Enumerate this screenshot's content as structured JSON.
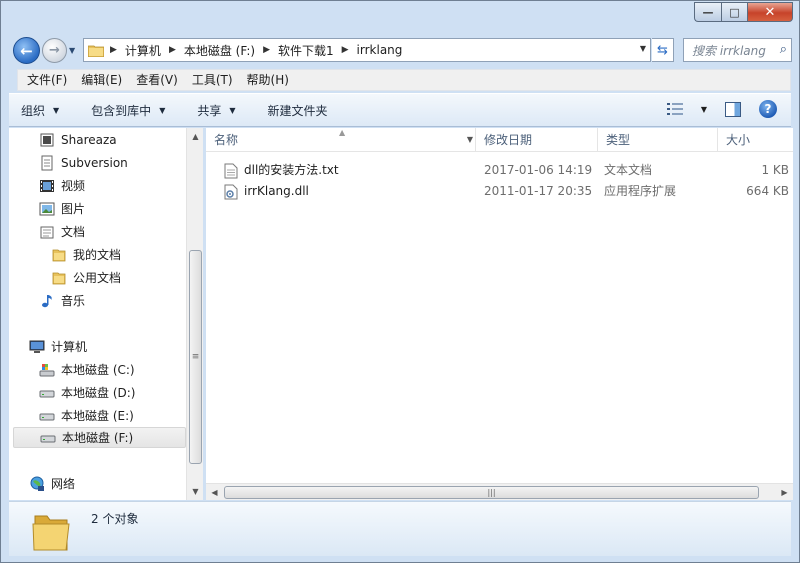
{
  "window": {
    "controls": {
      "minimize": "—",
      "maximize": "□",
      "close": "✕"
    }
  },
  "address": {
    "crumbs": [
      "计算机",
      "本地磁盘 (F:)",
      "软件下载1",
      "irrklang"
    ],
    "search_placeholder": "搜索 irrklang"
  },
  "menu": [
    "文件(F)",
    "编辑(E)",
    "查看(V)",
    "工具(T)",
    "帮助(H)"
  ],
  "commands": {
    "organize": "组织",
    "include_in_library": "包含到库中",
    "share": "共享",
    "new_folder": "新建文件夹"
  },
  "nav_pane": {
    "items": [
      {
        "label": "Shareaza",
        "icon": "shareaza-icon"
      },
      {
        "label": "Subversion",
        "icon": "subversion-icon"
      },
      {
        "label": "视频",
        "icon": "video-library-icon"
      },
      {
        "label": "图片",
        "icon": "pictures-library-icon"
      },
      {
        "label": "文档",
        "icon": "documents-library-icon"
      },
      {
        "label": "我的文档",
        "icon": "folder-icon"
      },
      {
        "label": "公用文档",
        "icon": "folder-icon"
      },
      {
        "label": "音乐",
        "icon": "music-library-icon"
      },
      {
        "label": "计算机",
        "icon": "computer-icon"
      },
      {
        "label": "本地磁盘 (C:)",
        "icon": "system-drive-icon"
      },
      {
        "label": "本地磁盘 (D:)",
        "icon": "drive-icon"
      },
      {
        "label": "本地磁盘 (E:)",
        "icon": "drive-icon"
      },
      {
        "label": "本地磁盘 (F:)",
        "icon": "drive-icon"
      },
      {
        "label": "网络",
        "icon": "network-icon"
      }
    ],
    "selected": "本地磁盘 (F:)"
  },
  "file_list": {
    "columns": [
      "名称",
      "修改日期",
      "类型",
      "大小"
    ],
    "files": [
      {
        "name": "dll的安装方法.txt",
        "modified": "2017-01-06 14:19",
        "type": "文本文档",
        "size": "1 KB",
        "icon": "text-file-icon"
      },
      {
        "name": "irrKlang.dll",
        "modified": "2011-01-17 20:35",
        "type": "应用程序扩展",
        "size": "664 KB",
        "icon": "dll-file-icon"
      }
    ]
  },
  "details": {
    "count": "2 个对象"
  },
  "colors": {
    "accent": "#2b6cc4",
    "frame": "#cfe0f3",
    "header_text": "#4c607a"
  }
}
